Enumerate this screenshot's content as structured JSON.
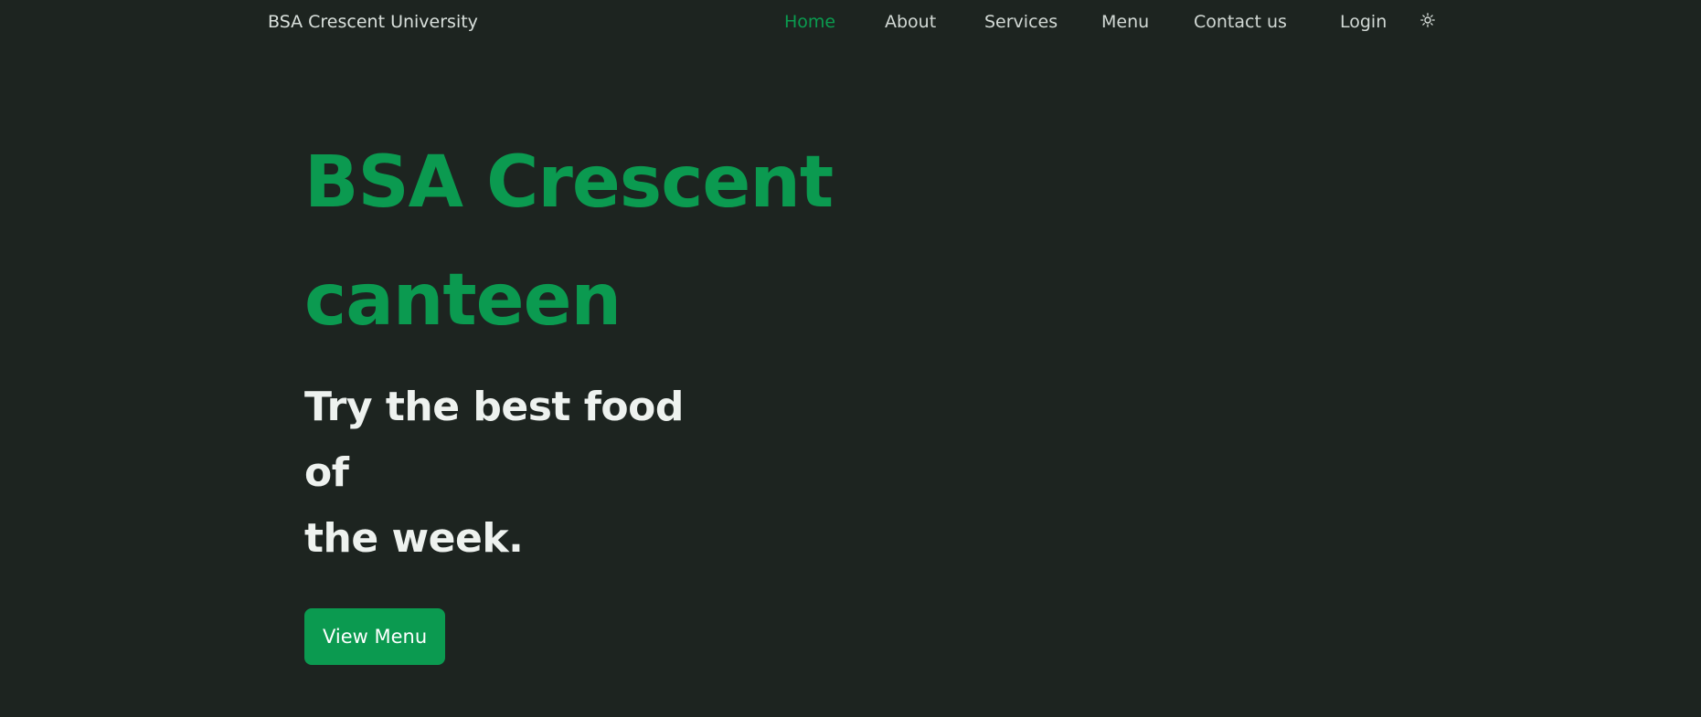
{
  "colors": {
    "background": "#1d2420",
    "accent": "#0b9a50",
    "nav_text": "#d2d9d5",
    "active_nav": "#0a9b4f",
    "hero_subtitle": "#eef2ef",
    "button_text": "#ffffff"
  },
  "header": {
    "brand": "BSA Crescent University",
    "nav": {
      "items": [
        {
          "label": "Home",
          "active": true
        },
        {
          "label": "About",
          "active": false
        },
        {
          "label": "Services",
          "active": false
        },
        {
          "label": "Menu",
          "active": false
        },
        {
          "label": "Contact us",
          "active": false
        },
        {
          "label": "Login",
          "active": false
        }
      ]
    },
    "theme_icon": "sun-icon"
  },
  "hero": {
    "title_line_1": "BSA Crescent",
    "title_line_2": "canteen",
    "subtitle_line_1": "Try the best food of",
    "subtitle_line_2": "the week.",
    "button_label": "View Menu"
  }
}
